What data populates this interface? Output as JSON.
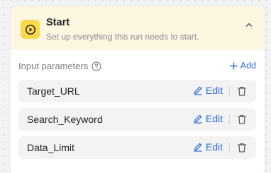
{
  "node": {
    "title": "Start",
    "subtitle": "Set up everything this run needs to start.",
    "accent_color": "#fbd84c",
    "header_bg": "#fdf6e1",
    "icon": "play-circle-icon",
    "collapse_icon": "chevron-up-icon"
  },
  "params_section": {
    "label": "Input parameters",
    "help_icon": "help-circle-icon",
    "add_label": "Add",
    "add_icon": "plus-icon"
  },
  "params": [
    {
      "name": "Target_URL",
      "edit_label": "Edit"
    },
    {
      "name": "Search_Keyword",
      "edit_label": "Edit"
    },
    {
      "name": "Data_Limit",
      "edit_label": "Edit"
    }
  ],
  "colors": {
    "link": "#2f6fdb",
    "row_bg": "#f3f3f4"
  }
}
